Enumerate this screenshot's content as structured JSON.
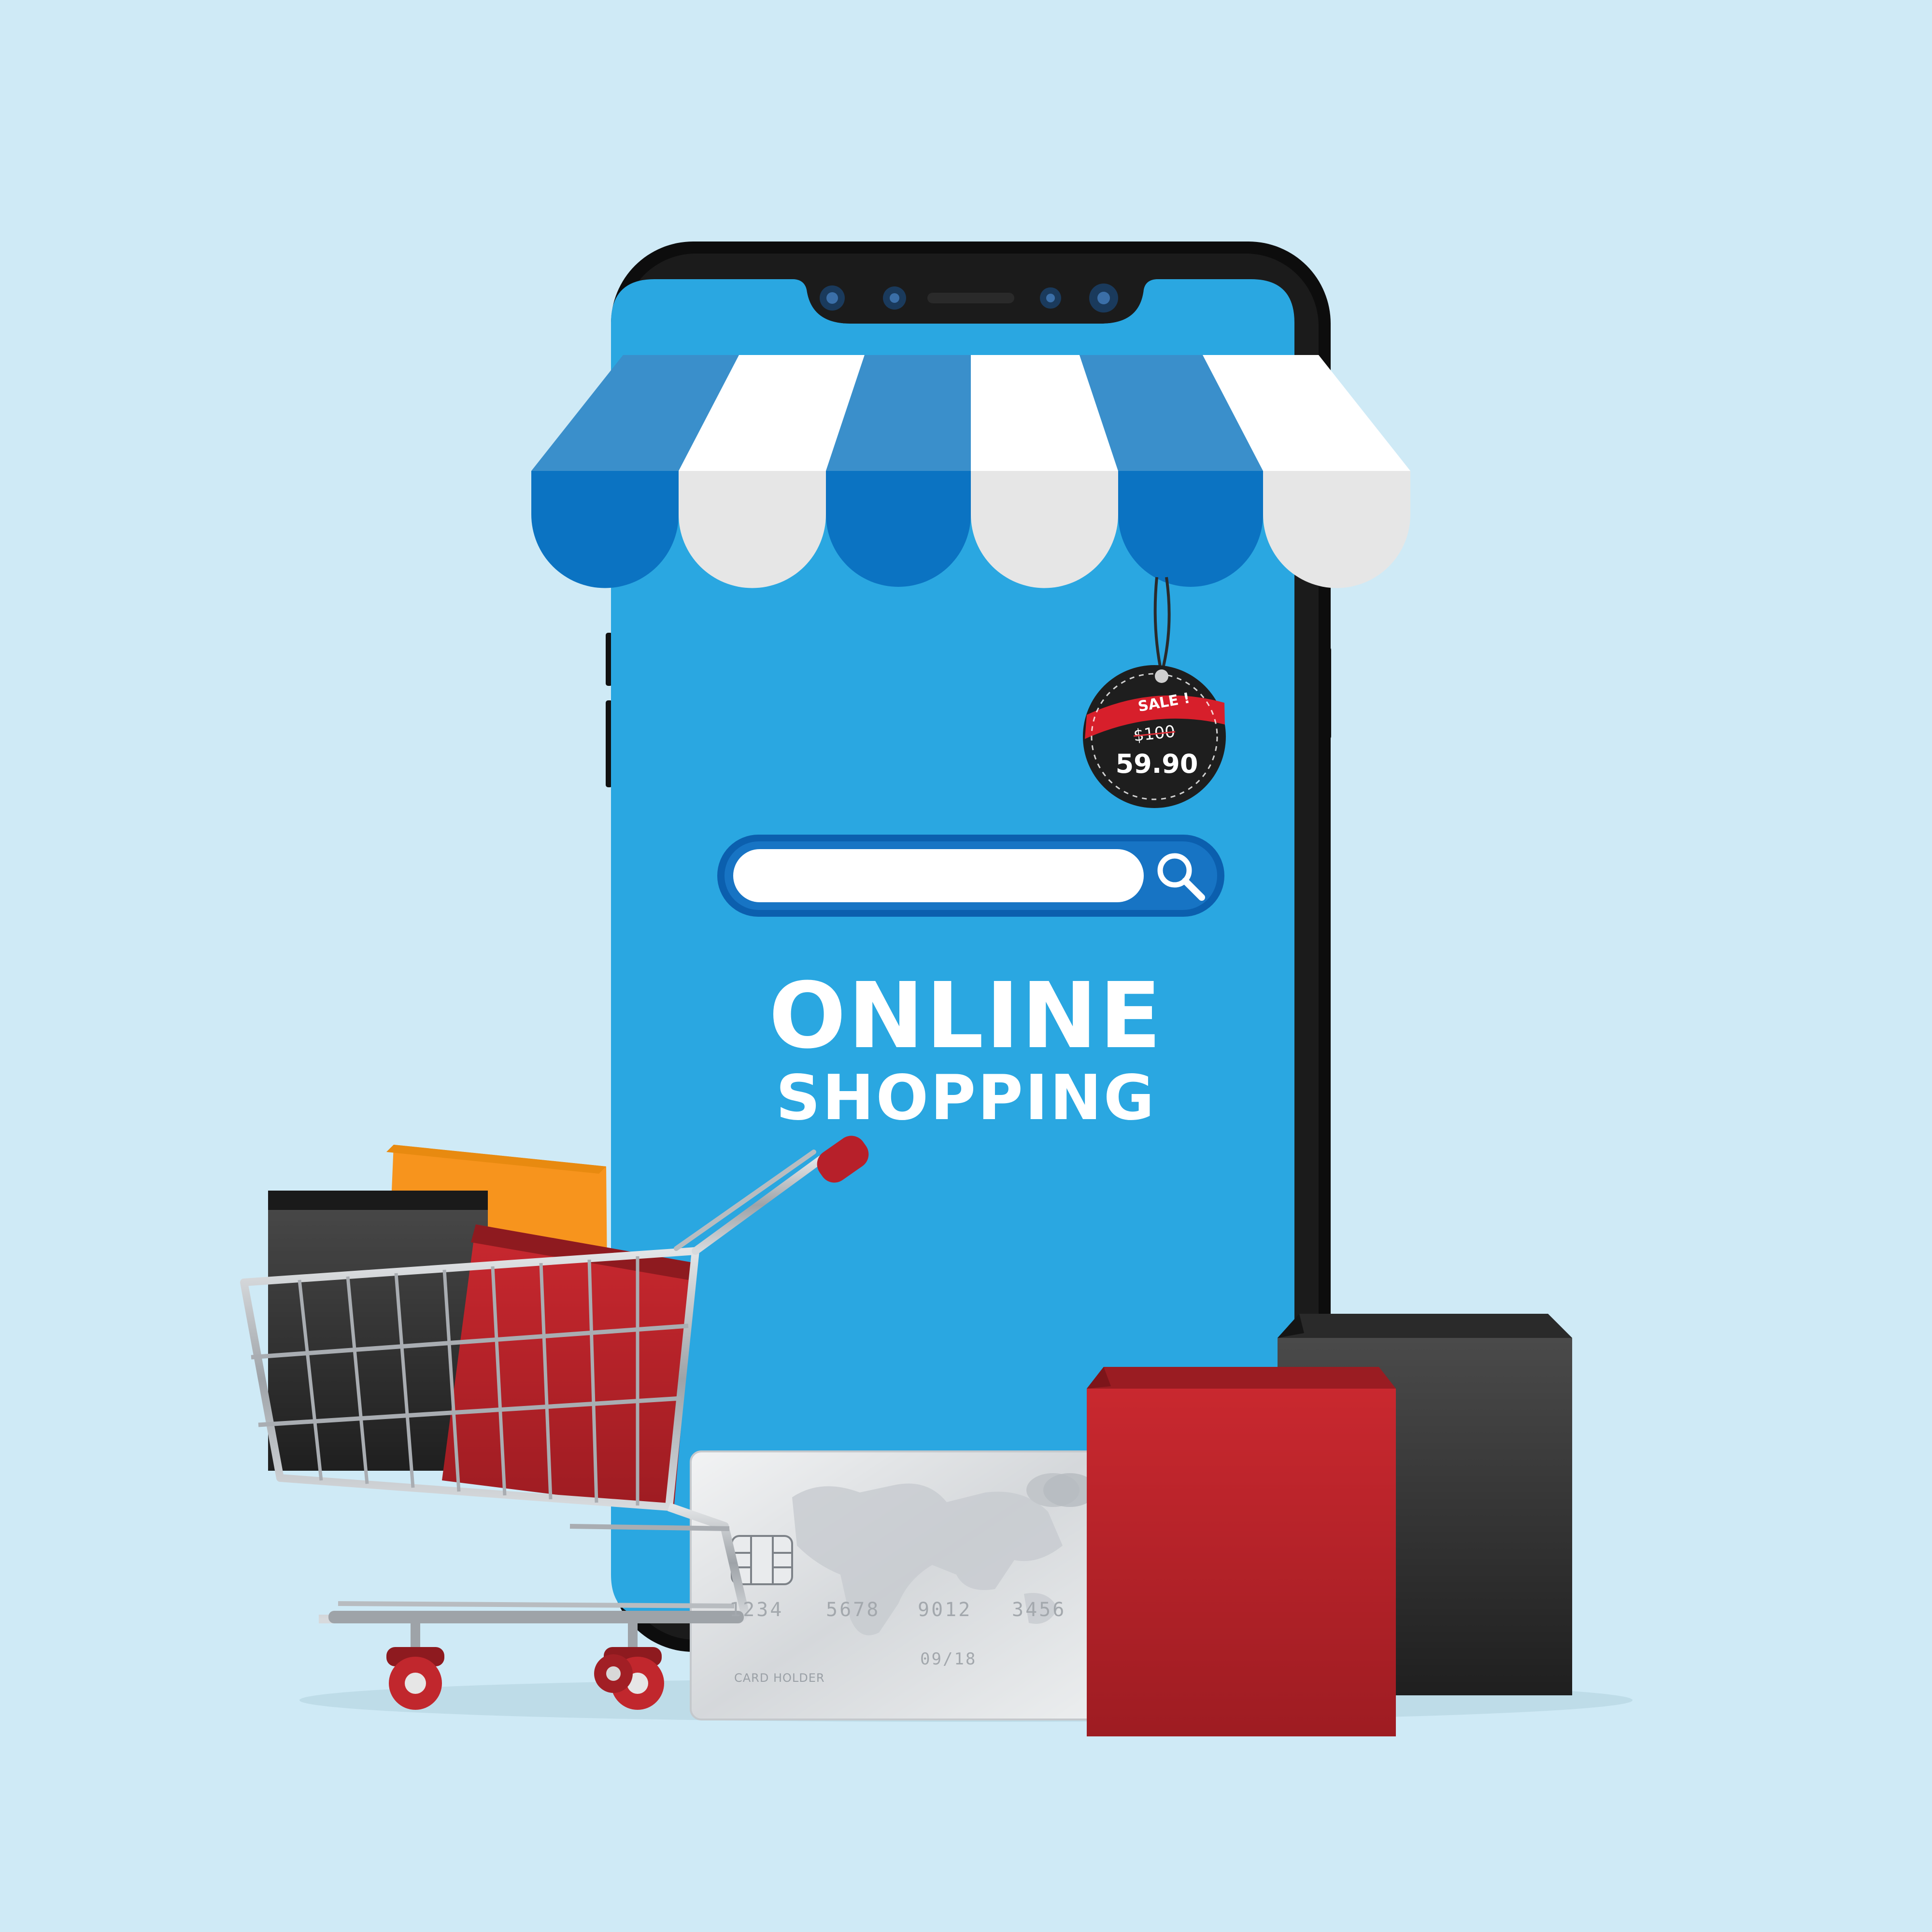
{
  "screen": {
    "title_line1": "ONLINE",
    "title_line2": "SHOPPING",
    "search": {
      "value": "",
      "placeholder": ""
    }
  },
  "sale_tag": {
    "label": "SALE !",
    "old_price": "$100",
    "new_price": "59.90"
  },
  "credit_card": {
    "number_groups": [
      "1234",
      "5678",
      "9012",
      "3456"
    ],
    "expiry": "09/18",
    "holder_label": "CARD HOLDER"
  },
  "icons": {
    "search": "search-icon",
    "cart": "shopping-cart-icon"
  },
  "colors": {
    "background": "#cfeaf6",
    "screen": "#2aa7e1",
    "awning_blue": "#0b73c2",
    "awning_white": "#e6e6e6",
    "bag_red": "#c1272d",
    "bag_black": "#3a3a3a",
    "bag_orange": "#f7941d"
  }
}
